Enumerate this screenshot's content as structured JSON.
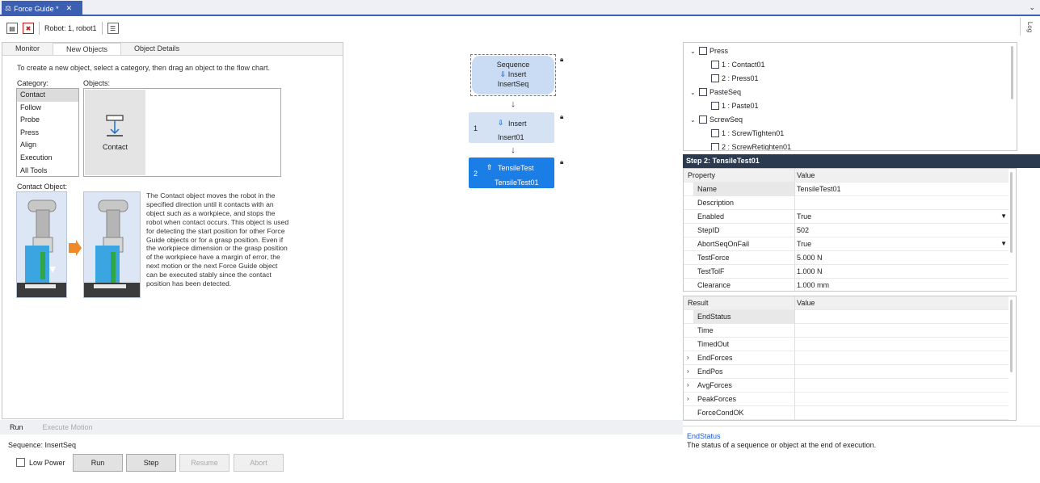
{
  "document_tab": {
    "title": "Force Guide *",
    "close": "✕"
  },
  "toolbar": {
    "robot_label": "Robot: 1, robot1"
  },
  "log_tab": "Log",
  "left_tabs": [
    "Monitor",
    "New Objects",
    "Object Details"
  ],
  "new_objects": {
    "instruction": "To create a new object, select a category, then drag an object to the flow chart.",
    "category_label": "Category:",
    "objects_label": "Objects:",
    "categories": [
      "Contact",
      "Follow",
      "Probe",
      "Press",
      "Align",
      "Execution",
      "All Tools"
    ],
    "object_tile": "Contact",
    "contact_object_label": "Contact Object:",
    "description": "The Contact object moves the robot in the specified direction until it contacts with an object such as a workpiece, and stops the robot when contact occurs. This object is used for detecting the start position for other Force Guide objects or for a grasp position.  Even if the workpiece dimension or the grasp position of the workpiece have a margin of error, the next motion or the next Force Guide object can be executed stably since the contact position has been detected."
  },
  "flow": {
    "sequence": {
      "type": "Sequence",
      "sub": "Insert",
      "name": "InsertSeq"
    },
    "nodes": [
      {
        "num": "1",
        "type": "Insert",
        "name": "Insert01"
      },
      {
        "num": "2",
        "type": "TensileTest",
        "name": "TensileTest01"
      }
    ]
  },
  "tree": {
    "items": [
      "Press",
      "1 : Contact01",
      "2 : Press01",
      "PasteSeq",
      "1 : Paste01",
      "ScrewSeq",
      "1 : ScrewTighten01",
      "2 : ScrewRetighten01"
    ]
  },
  "step_header": "Step 2: TensileTest01",
  "properties": {
    "col_property": "Property",
    "col_value": "Value",
    "rows": [
      {
        "k": "Name",
        "v": "TensileTest01"
      },
      {
        "k": "Description",
        "v": ""
      },
      {
        "k": "Enabled",
        "v": "True"
      },
      {
        "k": "StepID",
        "v": "502"
      },
      {
        "k": "AbortSeqOnFail",
        "v": "True"
      },
      {
        "k": "TestForce",
        "v": "5.000  N"
      },
      {
        "k": "TestTolF",
        "v": "1.000  N"
      },
      {
        "k": "Clearance",
        "v": "1.000  mm"
      }
    ]
  },
  "results": {
    "col_result": "Result",
    "col_value": "Value",
    "rows": [
      "EndStatus",
      "Time",
      "TimedOut",
      "EndForces",
      "EndPos",
      "AvgForces",
      "PeakForces",
      "ForceCondOK"
    ]
  },
  "help": {
    "title": "EndStatus",
    "text": "The status of a sequence or object at the end of execution."
  },
  "run_panel": {
    "tabs": [
      "Run",
      "Execute Motion"
    ],
    "sequence": "Sequence: InsertSeq",
    "low_power": "Low Power",
    "buttons": [
      "Run",
      "Step",
      "Resume",
      "Abort"
    ]
  },
  "colors": {
    "accent": "#3c5fb4",
    "selected_node": "#1a7ee6",
    "node": "#d4e2f4",
    "header": "#2b3a4e"
  }
}
